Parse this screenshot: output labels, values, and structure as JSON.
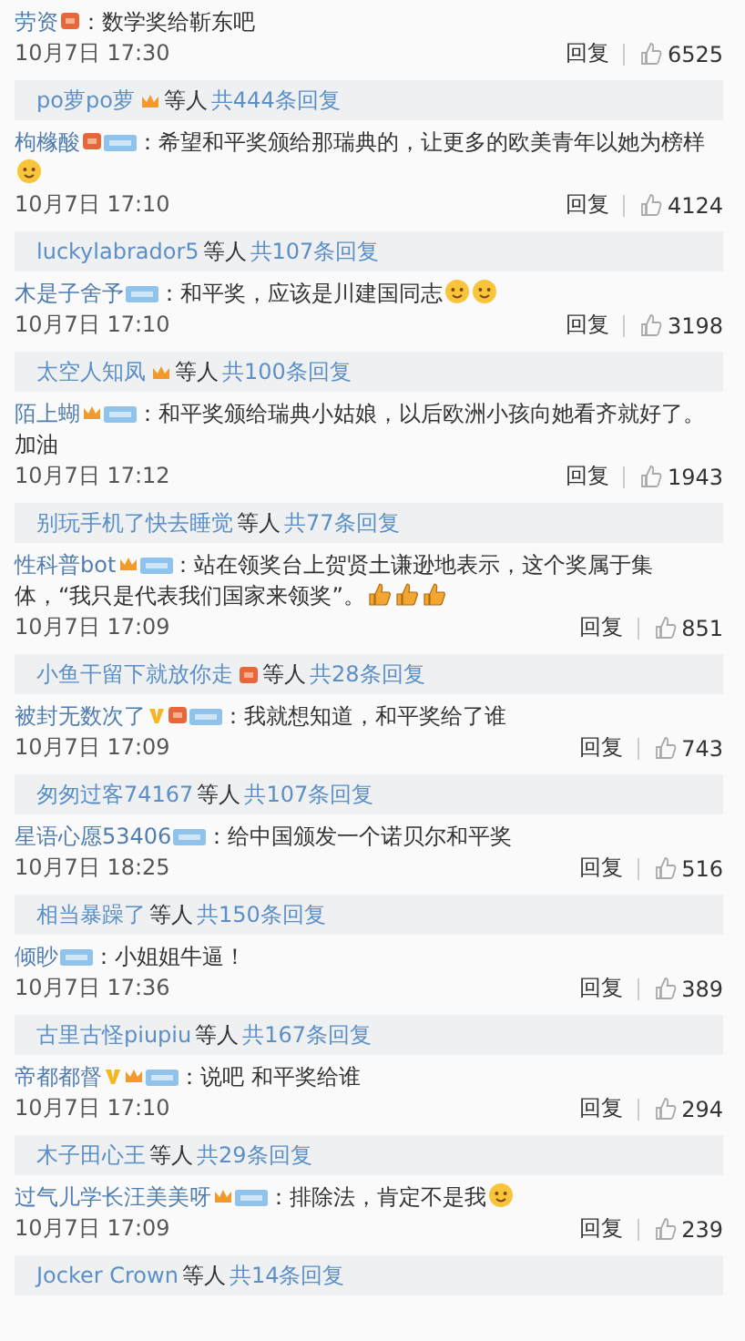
{
  "comments": [
    {
      "user": "劳资",
      "badges": [
        {
          "kind": "medal"
        }
      ],
      "text": "：数学奖给靳东吧",
      "time": "10月7日 17:30",
      "reply": "回复",
      "likes": "6525",
      "thread": {
        "user": "po萝po萝",
        "badges": [
          {
            "kind": "crown"
          }
        ],
        "others": "等人",
        "count": "共444条回复"
      }
    },
    {
      "user": "枸橼酸",
      "badges": [
        {
          "kind": "medal"
        },
        {
          "kind": "member"
        }
      ],
      "text": "：希望和平奖颁给那瑞典的，让更多的欧美青年以她为榜样",
      "emojis": [
        {
          "kind": "face"
        }
      ],
      "time": "10月7日 17:10",
      "reply": "回复",
      "likes": "4124",
      "thread": {
        "user": "luckylabrador5",
        "others": "等人",
        "count": "共107条回复"
      }
    },
    {
      "user": "木是子舍予",
      "badges": [
        {
          "kind": "member"
        }
      ],
      "text": "：和平奖，应该是川建国同志",
      "emojis": [
        {
          "kind": "face"
        },
        {
          "kind": "face"
        }
      ],
      "time": "10月7日 17:10",
      "reply": "回复",
      "likes": "3198",
      "thread": {
        "user": "太空人知凤",
        "badges": [
          {
            "kind": "crown"
          }
        ],
        "others": "等人",
        "count": "共100条回复"
      }
    },
    {
      "user": "陌上蝴",
      "badges": [
        {
          "kind": "crown"
        },
        {
          "kind": "member"
        }
      ],
      "text": "：和平奖颁给瑞典小姑娘，以后欧洲小孩向她看齐就好了。加油",
      "time": "10月7日 17:12",
      "reply": "回复",
      "likes": "1943",
      "thread": {
        "user": "别玩手机了快去睡觉",
        "others": "等人",
        "count": "共77条回复"
      }
    },
    {
      "user": "性科普bot",
      "badges": [
        {
          "kind": "crown"
        },
        {
          "kind": "member"
        }
      ],
      "text": "：站在领奖台上贺贤土谦逊地表示，这个奖属于集体，“我只是代表我们国家来领奖”。",
      "emojis": [
        {
          "kind": "thumb"
        },
        {
          "kind": "thumb"
        },
        {
          "kind": "thumb"
        }
      ],
      "time": "10月7日 17:09",
      "reply": "回复",
      "likes": "851",
      "thread": {
        "user": "小鱼干留下就放你走",
        "badges": [
          {
            "kind": "medal"
          }
        ],
        "others": "等人",
        "count": "共28条回复"
      }
    },
    {
      "user": "被封无数次了",
      "badges": [
        {
          "kind": "v"
        },
        {
          "kind": "medal"
        },
        {
          "kind": "member"
        }
      ],
      "text": "：我就想知道，和平奖给了谁",
      "time": "10月7日 17:09",
      "reply": "回复",
      "likes": "743",
      "thread": {
        "user": "匆匆过客74167",
        "others": "等人",
        "count": "共107条回复"
      }
    },
    {
      "user": "星语心愿53406",
      "badges": [
        {
          "kind": "member"
        }
      ],
      "text": "：给中国颁发一个诺贝尔和平奖",
      "time": "10月7日 18:25",
      "reply": "回复",
      "likes": "516",
      "thread": {
        "user": "相当暴躁了",
        "others": "等人",
        "count": "共150条回复"
      }
    },
    {
      "user": "倾眇",
      "badges": [
        {
          "kind": "member"
        }
      ],
      "text": "：小姐姐牛逼！",
      "time": "10月7日 17:36",
      "reply": "回复",
      "likes": "389",
      "thread": {
        "user": "古里古怪piupiu",
        "others": "等人",
        "count": "共167条回复"
      }
    },
    {
      "user": "帝都都督",
      "badges": [
        {
          "kind": "v"
        },
        {
          "kind": "crown"
        },
        {
          "kind": "member"
        }
      ],
      "text": "：说吧 和平奖给谁",
      "time": "10月7日 17:10",
      "reply": "回复",
      "likes": "294",
      "thread": {
        "user": "木子田心王",
        "others": "等人",
        "count": "共29条回复"
      }
    },
    {
      "user": "过气儿学长汪美美呀",
      "badges": [
        {
          "kind": "crown"
        },
        {
          "kind": "member"
        }
      ],
      "text": "：排除法，肯定不是我",
      "emojis": [
        {
          "kind": "face"
        }
      ],
      "time": "10月7日 17:09",
      "reply": "回复",
      "likes": "239",
      "thread": {
        "user": "Jocker Crown",
        "others": "等人",
        "count": "共14条回复"
      }
    }
  ]
}
